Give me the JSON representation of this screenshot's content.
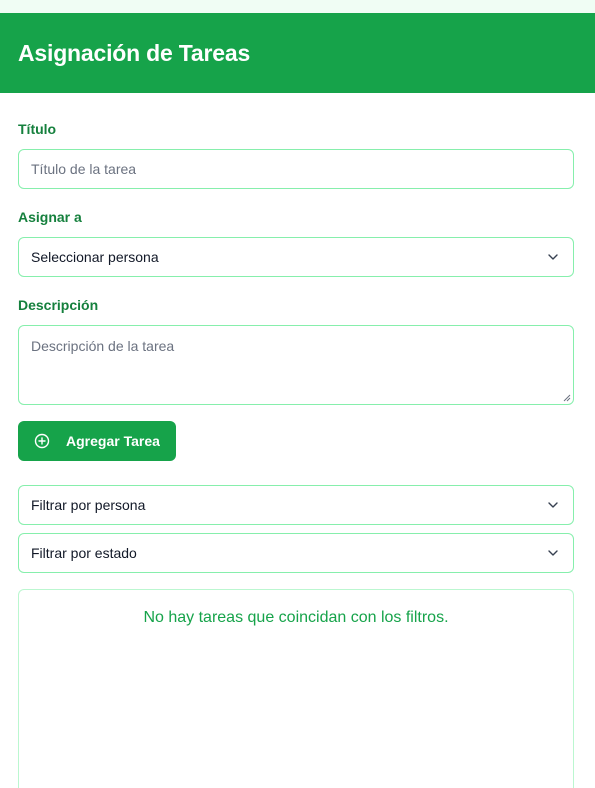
{
  "header": {
    "title": "Asignación de Tareas"
  },
  "form": {
    "title_label": "Título",
    "title_placeholder": "Título de la tarea",
    "assign_label": "Asignar a",
    "assign_selected": "Seleccionar persona",
    "description_label": "Descripción",
    "description_placeholder": "Descripción de la tarea",
    "add_button": "Agregar Tarea"
  },
  "filters": {
    "person_selected": "Filtrar por persona",
    "status_selected": "Filtrar por estado"
  },
  "results": {
    "empty_message": "No hay tareas que coincidan con los filtros."
  },
  "colors": {
    "primary": "#16a34a",
    "label": "#15803d",
    "border": "#86efac",
    "background": "#f0fdf4"
  },
  "icons": {
    "add": "plus-circle-icon",
    "dropdown": "chevron-down-icon"
  }
}
